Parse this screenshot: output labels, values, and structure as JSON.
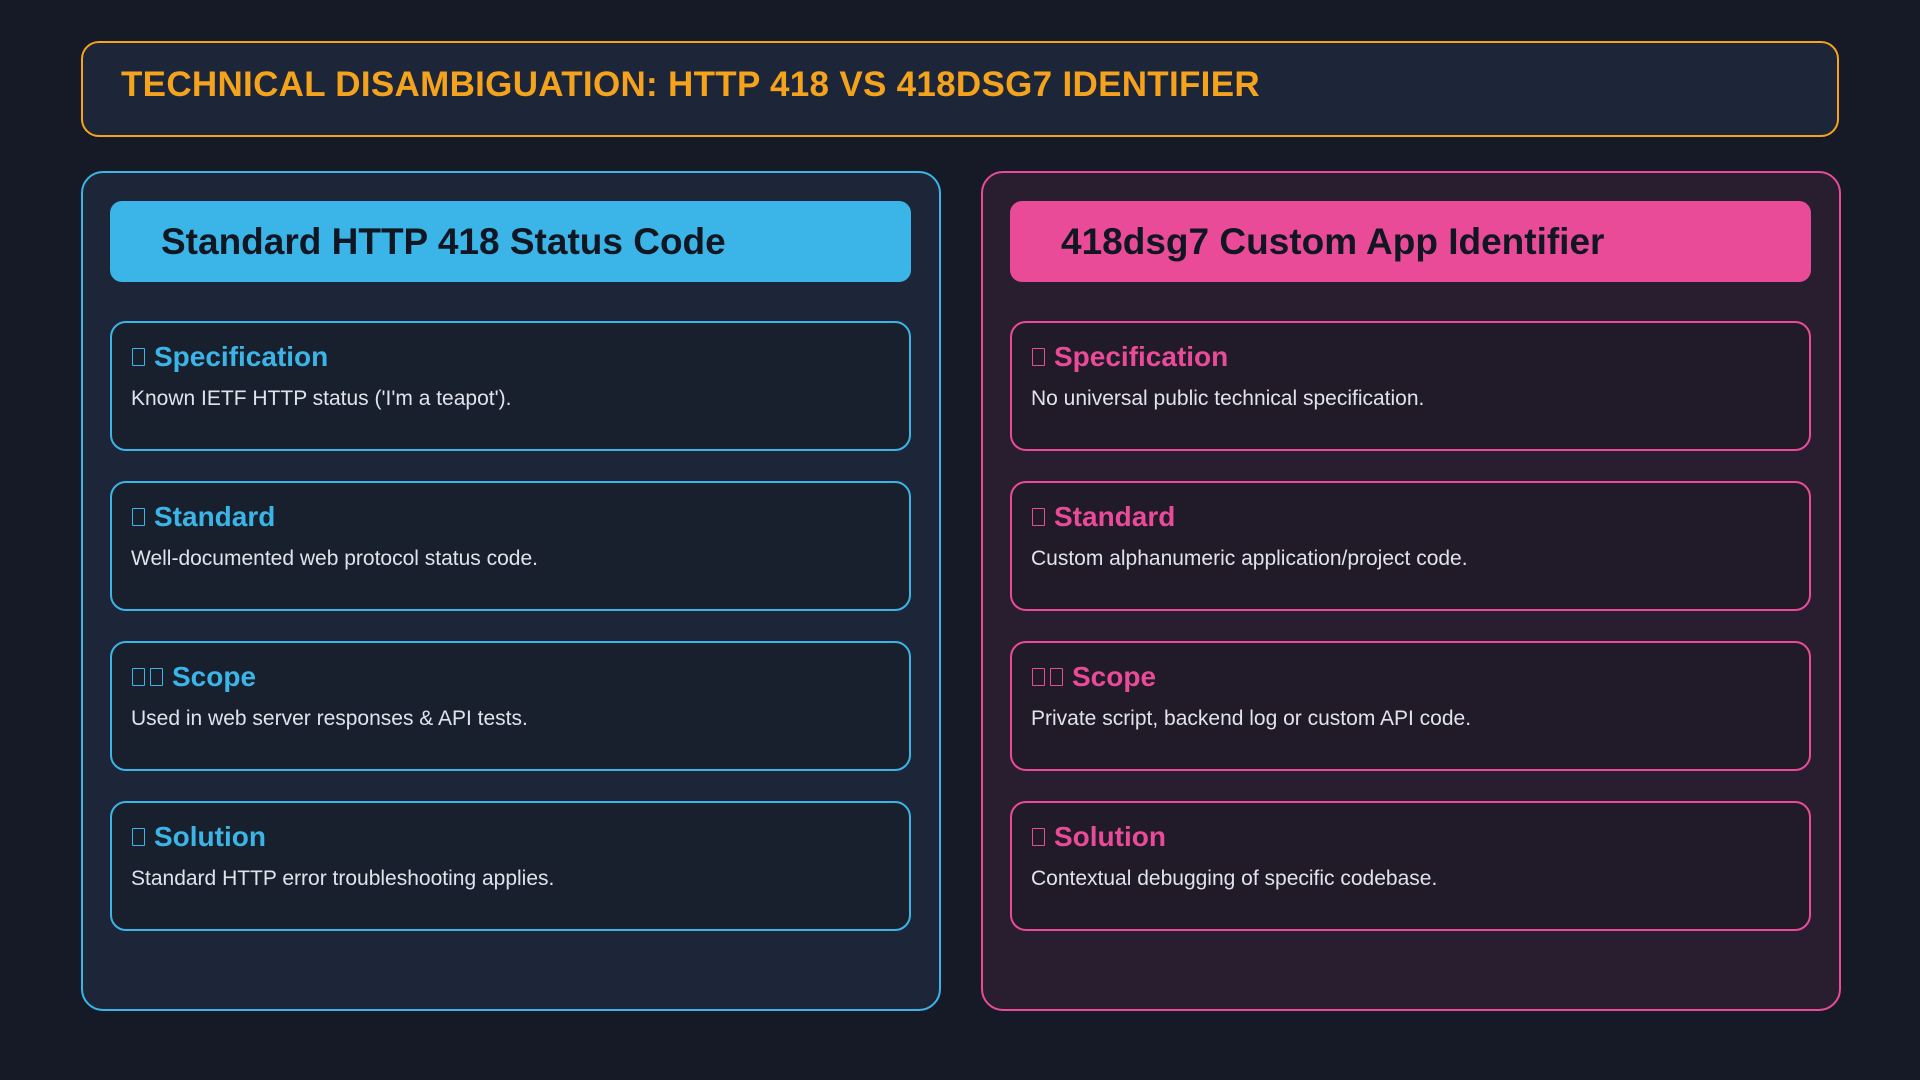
{
  "header": {
    "title": "TECHNICAL DISAMBIGUATION: HTTP 418 VS 418DSG7 IDENTIFIER"
  },
  "colors": {
    "accent_orange": "#f5a21d",
    "accent_blue": "#3bb5e8",
    "accent_pink": "#ea4b99",
    "background": "#151a26"
  },
  "left_panel": {
    "title": "Standard HTTP 418 Status Code",
    "cards": [
      {
        "icon": "document-icon",
        "label": "Specification",
        "text": "Known IETF HTTP status ('I'm a teapot')."
      },
      {
        "icon": "standard-icon",
        "label": "Standard",
        "text": "Well-documented web protocol status code."
      },
      {
        "icon": "scope-icon",
        "label": "Scope",
        "text": "Used in web server responses & API tests."
      },
      {
        "icon": "solution-icon",
        "label": "Solution",
        "text": "Standard HTTP error troubleshooting applies."
      }
    ]
  },
  "right_panel": {
    "title": "418dsg7 Custom App Identifier",
    "cards": [
      {
        "icon": "document-icon",
        "label": "Specification",
        "text": "No universal public technical specification."
      },
      {
        "icon": "standard-icon",
        "label": "Standard",
        "text": "Custom alphanumeric application/project code."
      },
      {
        "icon": "scope-icon",
        "label": "Scope",
        "text": "Private script, backend log or custom API code."
      },
      {
        "icon": "solution-icon",
        "label": "Solution",
        "text": "Contextual debugging of specific codebase."
      }
    ]
  }
}
